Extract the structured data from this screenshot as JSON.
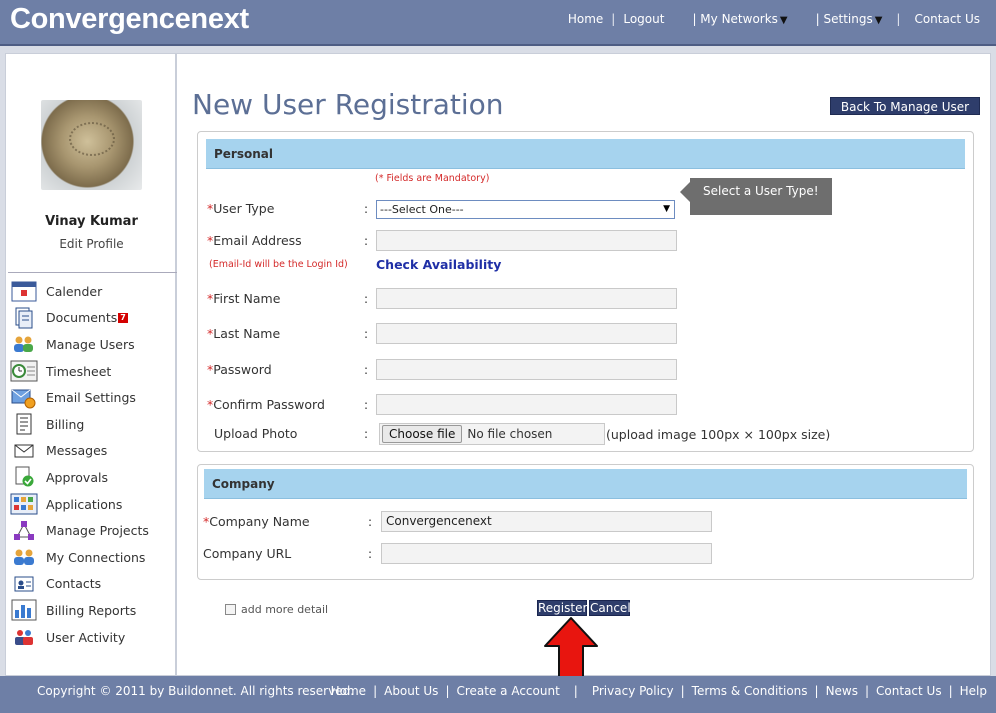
{
  "header": {
    "logo": "Convergencenext",
    "nav": {
      "home": "Home",
      "logout": "Logout",
      "my_networks": "| My Networks",
      "settings": "| Settings",
      "contact": "Contact Us",
      "sep": "|"
    }
  },
  "profile": {
    "name": "Vinay Kumar",
    "edit": "Edit Profile"
  },
  "sidebar": {
    "items": [
      {
        "label": "Calender"
      },
      {
        "label": "Documents",
        "badge": "7"
      },
      {
        "label": "Manage Users"
      },
      {
        "label": "Timesheet"
      },
      {
        "label": "Email Settings"
      },
      {
        "label": "Billing"
      },
      {
        "label": "Messages"
      },
      {
        "label": "Approvals"
      },
      {
        "label": "Applications"
      },
      {
        "label": "Manage Projects"
      },
      {
        "label": "My Connections"
      },
      {
        "label": "Contacts"
      },
      {
        "label": "Billing Reports"
      },
      {
        "label": "User Activity"
      }
    ]
  },
  "page": {
    "title": "New User Registration",
    "back_button": "Back To Manage User"
  },
  "personal": {
    "section_title": "Personal",
    "mandatory_note": "(* Fields are Mandatory)",
    "required_mark": "*",
    "colon": ":",
    "user_type_label": "User Type",
    "user_type_value": "---Select One---",
    "tooltip": "Select a User Type!",
    "email_label": "Email Address",
    "email_note": "(Email-Id will be the Login Id)",
    "check_availability": "Check Availability",
    "first_name_label": "First Name",
    "last_name_label": "Last Name",
    "password_label": "Password",
    "confirm_password_label": "Confirm Password",
    "upload_photo_label": "Upload Photo",
    "choose_file": "Choose file",
    "no_file": "No file chosen",
    "upload_hint": "(upload image 100px × 100px size)"
  },
  "company": {
    "section_title": "Company",
    "name_label": "Company Name",
    "name_value": "Convergencenext",
    "url_label": "Company URL"
  },
  "actions": {
    "add_more": "add more detail",
    "register": "Register",
    "cancel": "Cancel"
  },
  "footer": {
    "copyright": "Copyright © 2011 by Buildonnet. All rights reserved.",
    "links": [
      "Home",
      "About Us",
      "Create a Account",
      "Privacy Policy",
      "Terms & Conditions",
      "News",
      "Contact Us",
      "Help"
    ],
    "sep": "|"
  },
  "colors": {
    "header": "#6e7fa6",
    "section_bar": "#a6d3ee",
    "dark_button": "#2e3d6b",
    "required": "#d42a2a",
    "arrow": "#e8150f"
  }
}
